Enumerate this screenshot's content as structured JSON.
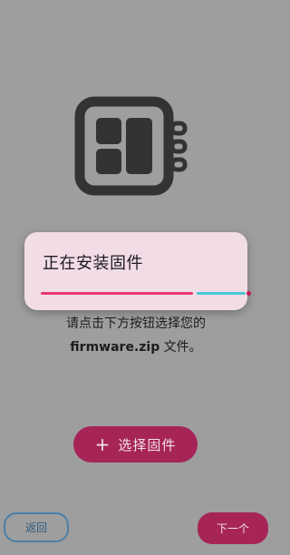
{
  "icons": {
    "chip": "chip-icon",
    "plus": "plus-icon"
  },
  "colors": {
    "background": "#9e9e9e",
    "dialog_bg": "#f2dde7",
    "accent": "#a62556",
    "progress_active": "#e8386f",
    "progress_rest": "#4dc7d2",
    "back_border": "#4a7fa8"
  },
  "dialog": {
    "title": "正在安装固件",
    "progress": 0.72
  },
  "instruction": {
    "line1": "请点击下方按钮选择您的",
    "filename": "firmware.zip",
    "line2_suffix": " 文件。"
  },
  "select_button": {
    "plus": "+",
    "label": "选择固件"
  },
  "nav": {
    "back_label": "返回",
    "next_label": "下一个"
  }
}
